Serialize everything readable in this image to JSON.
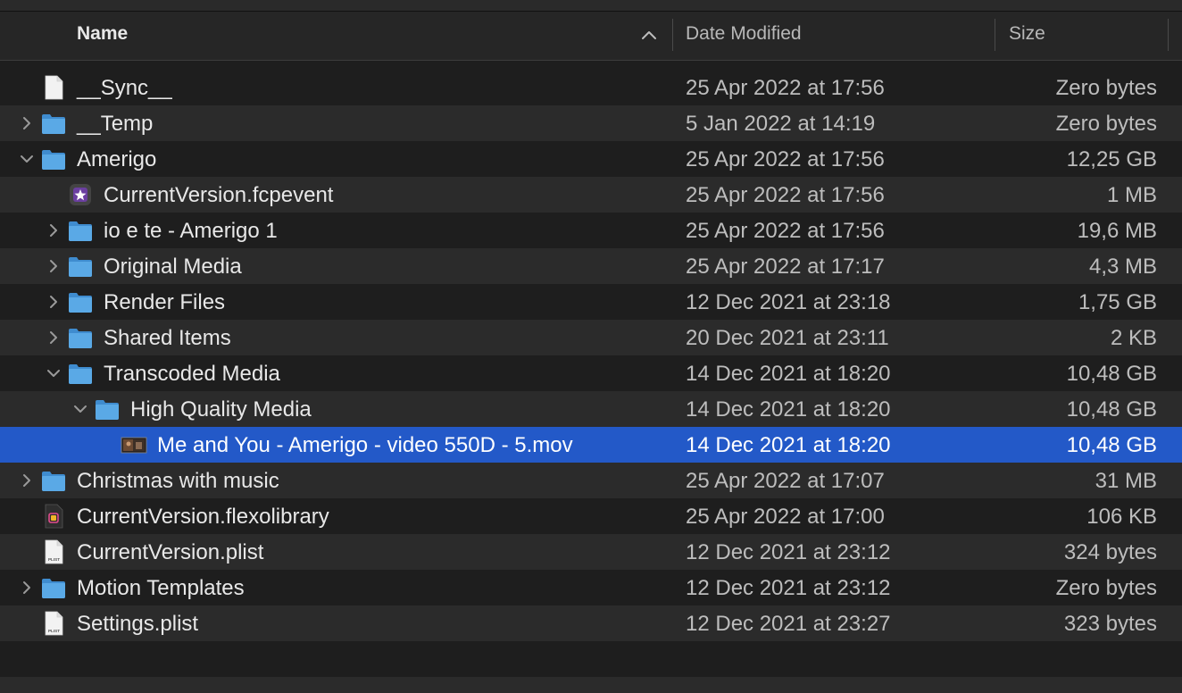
{
  "header": {
    "name_label": "Name",
    "date_label": "Date Modified",
    "size_label": "Size",
    "sort_direction": "ascending"
  },
  "rows": [
    {
      "name": "__Sync__",
      "date": "25 Apr 2022 at 17:56",
      "size": "Zero bytes",
      "level": 0,
      "disclosure": "none",
      "icon": "document-icon"
    },
    {
      "name": "__Temp",
      "date": "5 Jan 2022 at 14:19",
      "size": "Zero bytes",
      "level": 0,
      "disclosure": "collapsed",
      "icon": "folder-icon"
    },
    {
      "name": "Amerigo",
      "date": "25 Apr 2022 at 17:56",
      "size": "12,25 GB",
      "level": 0,
      "disclosure": "expanded",
      "icon": "folder-icon"
    },
    {
      "name": "CurrentVersion.fcpevent",
      "date": "25 Apr 2022 at 17:56",
      "size": "1 MB",
      "level": 1,
      "disclosure": "none",
      "icon": "fcpevent-icon"
    },
    {
      "name": "io e te - Amerigo 1",
      "date": "25 Apr 2022 at 17:56",
      "size": "19,6 MB",
      "level": 1,
      "disclosure": "collapsed",
      "icon": "folder-icon"
    },
    {
      "name": "Original Media",
      "date": "25 Apr 2022 at 17:17",
      "size": "4,3 MB",
      "level": 1,
      "disclosure": "collapsed",
      "icon": "folder-icon"
    },
    {
      "name": "Render Files",
      "date": "12 Dec 2021 at 23:18",
      "size": "1,75 GB",
      "level": 1,
      "disclosure": "collapsed",
      "icon": "folder-icon"
    },
    {
      "name": "Shared Items",
      "date": "20 Dec 2021 at 23:11",
      "size": "2 KB",
      "level": 1,
      "disclosure": "collapsed",
      "icon": "folder-icon"
    },
    {
      "name": "Transcoded Media",
      "date": "14 Dec 2021 at 18:20",
      "size": "10,48 GB",
      "level": 1,
      "disclosure": "expanded",
      "icon": "folder-icon"
    },
    {
      "name": "High Quality Media",
      "date": "14 Dec 2021 at 18:20",
      "size": "10,48 GB",
      "level": 2,
      "disclosure": "expanded",
      "icon": "folder-icon"
    },
    {
      "name": "Me and You - Amerigo - video 550D - 5.mov",
      "date": "14 Dec 2021 at 18:20",
      "size": "10,48 GB",
      "level": 3,
      "disclosure": "none",
      "icon": "video-thumbnail-icon",
      "selected": true
    },
    {
      "name": "Christmas with music",
      "date": "25 Apr 2022 at 17:07",
      "size": "31 MB",
      "level": 0,
      "disclosure": "collapsed",
      "icon": "folder-icon"
    },
    {
      "name": "CurrentVersion.flexolibrary",
      "date": "25 Apr 2022 at 17:00",
      "size": "106 KB",
      "level": 0,
      "disclosure": "none",
      "icon": "flexolibrary-icon"
    },
    {
      "name": "CurrentVersion.plist",
      "date": "12 Dec 2021 at 23:12",
      "size": "324 bytes",
      "level": 0,
      "disclosure": "none",
      "icon": "plist-icon"
    },
    {
      "name": "Motion Templates",
      "date": "12 Dec 2021 at 23:12",
      "size": "Zero bytes",
      "level": 0,
      "disclosure": "collapsed",
      "icon": "folder-icon"
    },
    {
      "name": "Settings.plist",
      "date": "12 Dec 2021 at 23:27",
      "size": "323 bytes",
      "level": 0,
      "disclosure": "none",
      "icon": "plist-icon"
    }
  ],
  "colors": {
    "background": "#1e1e1e",
    "row_alt": "#2b2b2b",
    "selection": "#2359c8",
    "folder": "#5aa9e6"
  },
  "icon_labels": {
    "plist": "PLIST"
  }
}
